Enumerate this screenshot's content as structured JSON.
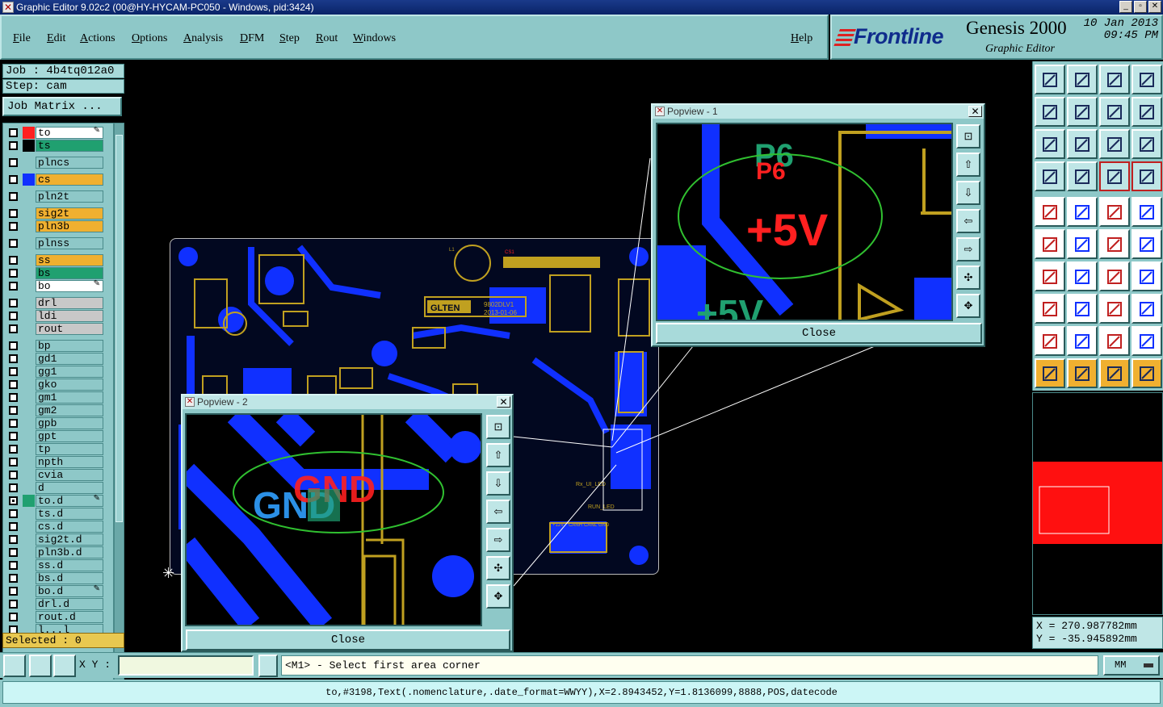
{
  "window": {
    "title": "Graphic Editor 9.02c2 (00@HY-HYCAM-PC050 - Windows, pid:3424)"
  },
  "menu": [
    "File",
    "Edit",
    "Actions",
    "Options",
    "Analysis",
    "DFM",
    "Step",
    "Rout",
    "Windows"
  ],
  "help": "Help",
  "brand": {
    "logo": "Frontline",
    "product": "Genesis 2000",
    "subtitle": "Graphic Editor",
    "date": "10 Jan 2013",
    "time": "09:45 PM"
  },
  "job": {
    "job_line": "Job : 4b4tq012a0",
    "step_line": "Step: cam",
    "matrix_button": "Job Matrix ..."
  },
  "layers": [
    {
      "name": "to",
      "color": "#ff2020",
      "bg": "#ffffff",
      "mark": "✎",
      "on": false
    },
    {
      "name": "ts",
      "color": "#000000",
      "bg": "#20a070",
      "on": false
    },
    {
      "name": "plncs",
      "color": "",
      "bg": "#8ec8c8",
      "on": false
    },
    {
      "name": "cs",
      "color": "#1030ff",
      "bg": "#f0b030",
      "on": false
    },
    {
      "name": "pln2t",
      "color": "",
      "bg": "#8ec8c8",
      "on": false
    },
    {
      "name": "sig2t",
      "color": "",
      "bg": "#f0b030",
      "on": false
    },
    {
      "name": "pln3b",
      "color": "",
      "bg": "#f0b030",
      "on": false
    },
    {
      "name": "plnss",
      "color": "",
      "bg": "#8ec8c8",
      "on": false
    },
    {
      "name": "ss",
      "color": "",
      "bg": "#f0b030",
      "on": false
    },
    {
      "name": "bs",
      "color": "",
      "bg": "#20a070",
      "on": false
    },
    {
      "name": "bo",
      "color": "",
      "bg": "#ffffff",
      "mark": "✎",
      "on": false
    },
    {
      "name": "drl",
      "color": "",
      "bg": "#c8c8c8",
      "on": false
    },
    {
      "name": "ldi",
      "color": "",
      "bg": "#c8c8c8",
      "on": false
    },
    {
      "name": "rout",
      "color": "",
      "bg": "#c8c8c8",
      "on": false
    },
    {
      "name": "bp",
      "color": "",
      "bg": "#8ec8c8",
      "on": false
    },
    {
      "name": "gd1",
      "color": "",
      "bg": "#8ec8c8",
      "on": false
    },
    {
      "name": "gg1",
      "color": "",
      "bg": "#8ec8c8",
      "on": false
    },
    {
      "name": "gko",
      "color": "",
      "bg": "#8ec8c8",
      "on": false
    },
    {
      "name": "gm1",
      "color": "",
      "bg": "#8ec8c8",
      "on": false
    },
    {
      "name": "gm2",
      "color": "",
      "bg": "#8ec8c8",
      "on": false
    },
    {
      "name": "gpb",
      "color": "",
      "bg": "#8ec8c8",
      "on": false
    },
    {
      "name": "gpt",
      "color": "",
      "bg": "#8ec8c8",
      "on": false
    },
    {
      "name": "tp",
      "color": "",
      "bg": "#8ec8c8",
      "on": false
    },
    {
      "name": "npth",
      "color": "",
      "bg": "#8ec8c8",
      "on": false
    },
    {
      "name": "cvia",
      "color": "",
      "bg": "#8ec8c8",
      "on": false
    },
    {
      "name": "d",
      "color": "",
      "bg": "#8ec8c8",
      "on": false
    },
    {
      "name": "to.d",
      "color": "#20a070",
      "bg": "#8ec8c8",
      "mark": "✎",
      "on": true
    },
    {
      "name": "ts.d",
      "color": "",
      "bg": "#8ec8c8",
      "on": false
    },
    {
      "name": "cs.d",
      "color": "",
      "bg": "#8ec8c8",
      "on": false
    },
    {
      "name": "sig2t.d",
      "color": "",
      "bg": "#8ec8c8",
      "on": false
    },
    {
      "name": "pln3b.d",
      "color": "",
      "bg": "#8ec8c8",
      "on": false
    },
    {
      "name": "ss.d",
      "color": "",
      "bg": "#8ec8c8",
      "on": false
    },
    {
      "name": "bs.d",
      "color": "",
      "bg": "#8ec8c8",
      "on": false
    },
    {
      "name": "bo.d",
      "color": "",
      "bg": "#8ec8c8",
      "mark": "✎",
      "on": false
    },
    {
      "name": "drl.d",
      "color": "",
      "bg": "#8ec8c8",
      "on": false
    },
    {
      "name": "rout.d",
      "color": "",
      "bg": "#8ec8c8",
      "on": false
    },
    {
      "name": "l...l",
      "color": "",
      "bg": "#8ec8c8",
      "on": false
    }
  ],
  "selected": "Selected : 0",
  "popview1": {
    "title": "Popview - 1",
    "close": "Close",
    "labels": [
      "P6",
      "+5V",
      "+5V"
    ]
  },
  "popview2": {
    "title": "Popview - 2",
    "close": "Close",
    "labels": [
      "GND",
      "GND"
    ]
  },
  "board": {
    "silk": [
      "GLTEN",
      "9802DLV1",
      "2013-01-06",
      "Rx_UI_LED",
      "RUN_LED",
      "+12V",
      "CANH",
      "CANL",
      "GND",
      "L1",
      "CS1"
    ]
  },
  "coords": {
    "x": "X = 270.987782mm",
    "y": "Y = -35.945892mm"
  },
  "cmd": {
    "xy_label": "X Y :",
    "xy_value": "",
    "prompt": "<M1> - Select first area corner",
    "units": "MM"
  },
  "status": "to,#3198,Text(.nomenclature,.date_format=WWYY),X=2.8943452,Y=1.8136099,8888,POS,datecode",
  "colors": {
    "panel": "#8ec8c8",
    "copper": "#1030ff",
    "trace": "#c0a020",
    "silk_red": "#ff2020",
    "silk_green": "#20a070",
    "highlight": "#30c030"
  }
}
